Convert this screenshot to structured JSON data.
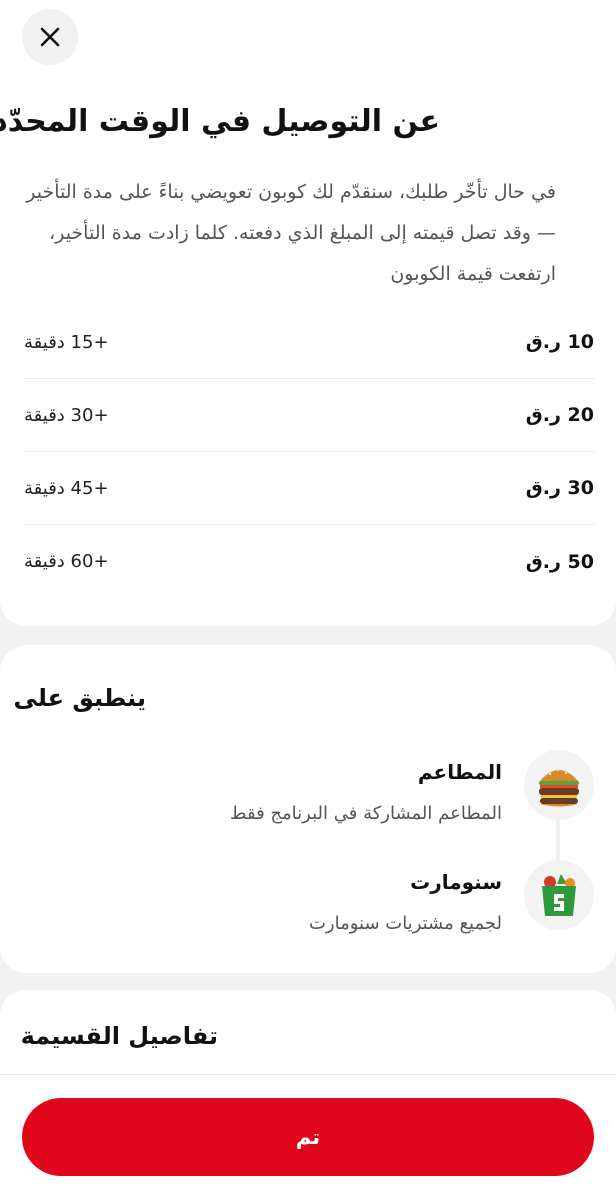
{
  "header": {
    "close_icon": "close-icon",
    "title": "عن التوصيل في الوقت المحدّد",
    "description": "في حال تأخّر طلبك، سنقدّم لك كوبون تعويضي بناءً على مدة التأخير — وقد تصل قيمته إلى المبلغ الذي دفعته. كلما زادت مدة التأخير، ارتفعت قيمة الكوبون"
  },
  "compensation_rows": [
    {
      "amount": "10 ر.ق",
      "delay": "+15 دقيقة"
    },
    {
      "amount": "20 ر.ق",
      "delay": "+30 دقيقة"
    },
    {
      "amount": "30 ر.ق",
      "delay": "+45 دقيقة"
    },
    {
      "amount": "50 ر.ق",
      "delay": "+60 دقيقة"
    }
  ],
  "applies_to": {
    "title": "ينطبق على",
    "items": [
      {
        "name": "المطاعم",
        "sub": "المطاعم المشاركة في البرنامج فقط",
        "icon": "burger-icon"
      },
      {
        "name": "سنومارت",
        "sub": "لجميع مشتريات سنومارت",
        "icon": "grocery-bag-icon"
      }
    ]
  },
  "details": {
    "title": "تفاصيل القسيمة"
  },
  "footer": {
    "done_label": "تم"
  },
  "colors": {
    "accent": "#e0061c",
    "background": "#f2f2f3"
  }
}
